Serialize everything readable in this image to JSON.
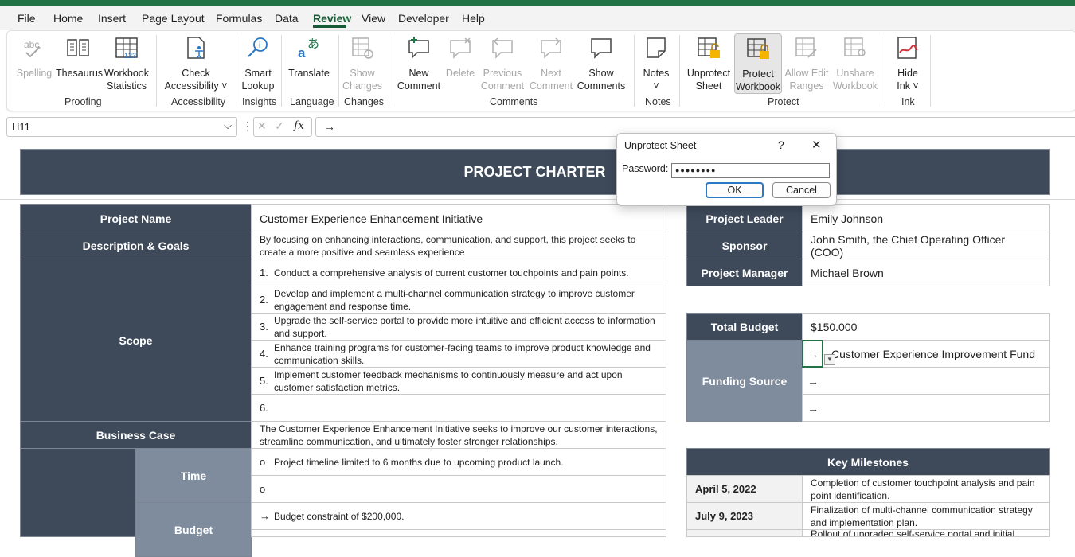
{
  "menu": [
    "File",
    "Home",
    "Insert",
    "Page Layout",
    "Formulas",
    "Data",
    "Review",
    "View",
    "Developer",
    "Help"
  ],
  "ribbon": {
    "buttons": {
      "spelling": "Spelling",
      "thesaurus": "Thesaurus",
      "workbook_statistics": "Workbook\nStatistics",
      "check_accessibility": "Check\nAccessibility ˅",
      "smart_lookup": "Smart\nLookup",
      "translate": "Translate",
      "show_changes": "Show\nChanges",
      "new_comment": "New\nComment",
      "delete": "Delete",
      "previous_comment": "Previous\nComment",
      "next_comment": "Next\nComment",
      "show_comments": "Show\nComments",
      "notes": "Notes\n˅",
      "unprotect_sheet": "Unprotect\nSheet",
      "protect_workbook": "Protect\nWorkbook",
      "allow_edit_ranges": "Allow Edit\nRanges",
      "unshare_workbook": "Unshare\nWorkbook",
      "hide_ink": "Hide\nInk ˅"
    },
    "groups": {
      "proofing": "Proofing",
      "accessibility": "Accessibility",
      "insights": "Insights",
      "language": "Language",
      "changes": "Changes",
      "comments": "Comments",
      "notes": "Notes",
      "protect": "Protect",
      "ink": "Ink"
    }
  },
  "formula_bar": {
    "name_box": "H11",
    "fx": "fx",
    "content": "→"
  },
  "dialog": {
    "title": "Unprotect Sheet",
    "help": "?",
    "close": "✕",
    "password_label": "Password:",
    "password_value": "●●●●●●●●",
    "ok": "OK",
    "cancel": "Cancel"
  },
  "sheet": {
    "title": "PROJECT CHARTER",
    "project_name_label": "Project Name",
    "project_name": "Customer Experience Enhancement Initiative",
    "description_label": "Description & Goals",
    "description": "By focusing on enhancing interactions, communication, and support, this project seeks to create a more positive and seamless experience",
    "scope_label": "Scope",
    "scope": [
      {
        "n": "1.",
        "t": "Conduct a comprehensive analysis of current customer touchpoints and pain points."
      },
      {
        "n": "2.",
        "t": "Develop and implement a multi-channel communication strategy to improve customer engagement and response time."
      },
      {
        "n": "3.",
        "t": "Upgrade the self-service portal to provide more intuitive and efficient access to information and support."
      },
      {
        "n": "4.",
        "t": "Enhance training programs for customer-facing teams to improve product knowledge and communication skills."
      },
      {
        "n": "5.",
        "t": "Implement customer feedback mechanisms to continuously measure and act upon customer satisfaction metrics."
      },
      {
        "n": "6.",
        "t": ""
      }
    ],
    "business_case_label": "Business Case",
    "business_case": "The Customer Experience Enhancement Initiative seeks to improve our customer interactions, streamline communication, and ultimately foster stronger relationships.",
    "time_label": "Time",
    "time_items": [
      {
        "b": "o",
        "t": "Project timeline limited to 6 months due to upcoming product launch."
      },
      {
        "b": "o",
        "t": ""
      }
    ],
    "budget_label": "Budget",
    "budget_items": [
      {
        "b": "→",
        "t": "Budget constraint of $200,000."
      }
    ],
    "project_leader_label": "Project Leader",
    "project_leader": "Emily Johnson",
    "sponsor_label": "Sponsor",
    "sponsor": "John Smith, the Chief Operating Officer (COO)",
    "project_manager_label": "Project Manager",
    "project_manager": "Michael Brown",
    "total_budget_label": "Total Budget",
    "total_budget": "$150.000",
    "funding_source_label": "Funding Source",
    "funding_sources": [
      {
        "b": "→",
        "t": "Customer Experience Improvement Fund"
      },
      {
        "b": "→",
        "t": ""
      },
      {
        "b": "→",
        "t": ""
      }
    ],
    "milestones_label": "Key Milestones",
    "milestones": [
      {
        "date": "April 5, 2022",
        "desc": "Completion of customer touchpoint analysis and pain point identification."
      },
      {
        "date": "July 9, 2023",
        "desc": "Finalization of multi-channel communication strategy and implementation plan."
      },
      {
        "date": "",
        "desc": "Rollout of upgraded self-service portal and initial"
      }
    ]
  }
}
